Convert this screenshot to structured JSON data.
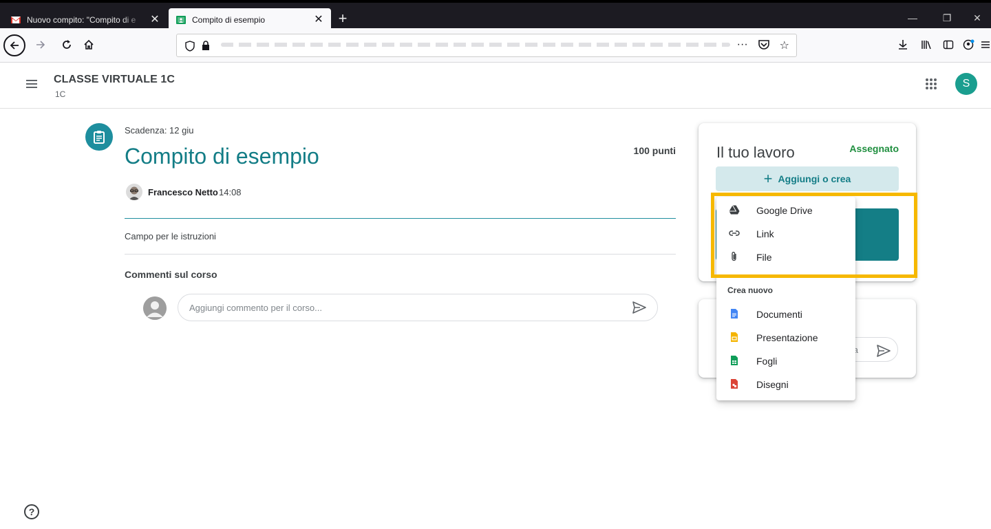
{
  "browser": {
    "tabs": [
      {
        "title": "Nuovo compito: \"Compito di e",
        "active": false
      },
      {
        "title": "Compito di esempio",
        "active": true
      }
    ]
  },
  "header": {
    "class_name": "CLASSE VIRTUALE 1C",
    "section": "1C",
    "avatar_letter": "S"
  },
  "assignment": {
    "due": "Scadenza: 12 giu",
    "title": "Compito di esempio",
    "points": "100 punti",
    "author": "Francesco Netto",
    "time": "14:08",
    "instructions": "Campo per le istruzioni"
  },
  "comments": {
    "title": "Commenti sul corso",
    "placeholder": "Aggiungi commento per il corso..."
  },
  "work": {
    "title": "Il tuo lavoro",
    "status": "Assegnato",
    "add_label": "Aggiungi o crea"
  },
  "private_comment": {
    "placeholder_fragment": "riva"
  },
  "dropdown": {
    "items": [
      {
        "label": "Google Drive",
        "icon": "google-drive-icon"
      },
      {
        "label": "Link",
        "icon": "link-icon"
      },
      {
        "label": "File",
        "icon": "paperclip-icon"
      }
    ],
    "section_label": "Crea nuovo",
    "create_items": [
      {
        "label": "Documenti",
        "icon": "docs-icon",
        "color": "#4285f4"
      },
      {
        "label": "Presentazione",
        "icon": "slides-icon",
        "color": "#f4b400"
      },
      {
        "label": "Fogli",
        "icon": "sheets-icon",
        "color": "#0f9d58"
      },
      {
        "label": "Disegni",
        "icon": "drawings-icon",
        "color": "#db4437"
      }
    ]
  },
  "colors": {
    "accent": "#137d86",
    "highlight": "#f6b800",
    "status_green": "#1e8e3e"
  }
}
